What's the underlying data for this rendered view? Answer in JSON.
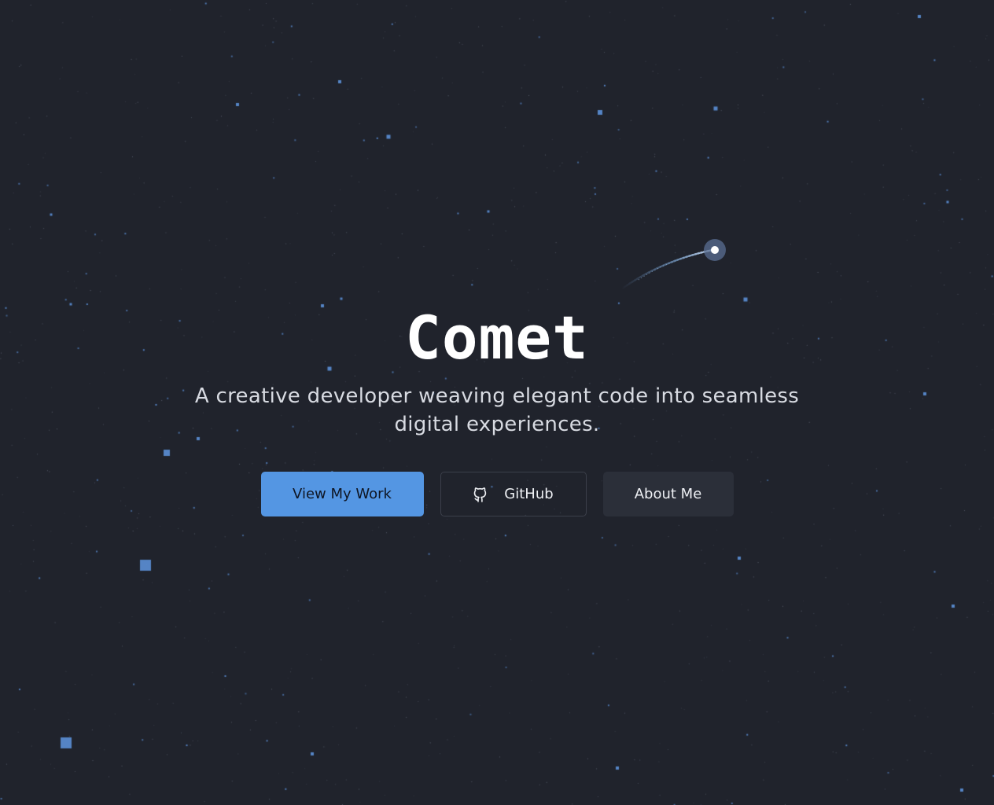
{
  "hero": {
    "title": "Comet",
    "subtitle": "A creative developer weaving elegant code into seamless digital experiences."
  },
  "actions": {
    "primary_label": "View My Work",
    "github_label": "GitHub",
    "about_label": "About Me"
  },
  "icons": {
    "github": "github-icon"
  },
  "colors": {
    "background": "#20232c",
    "accent": "#5496e3",
    "star": "#5b8fd6",
    "text": "#ffffff",
    "subtitle": "#d8dbe2"
  }
}
